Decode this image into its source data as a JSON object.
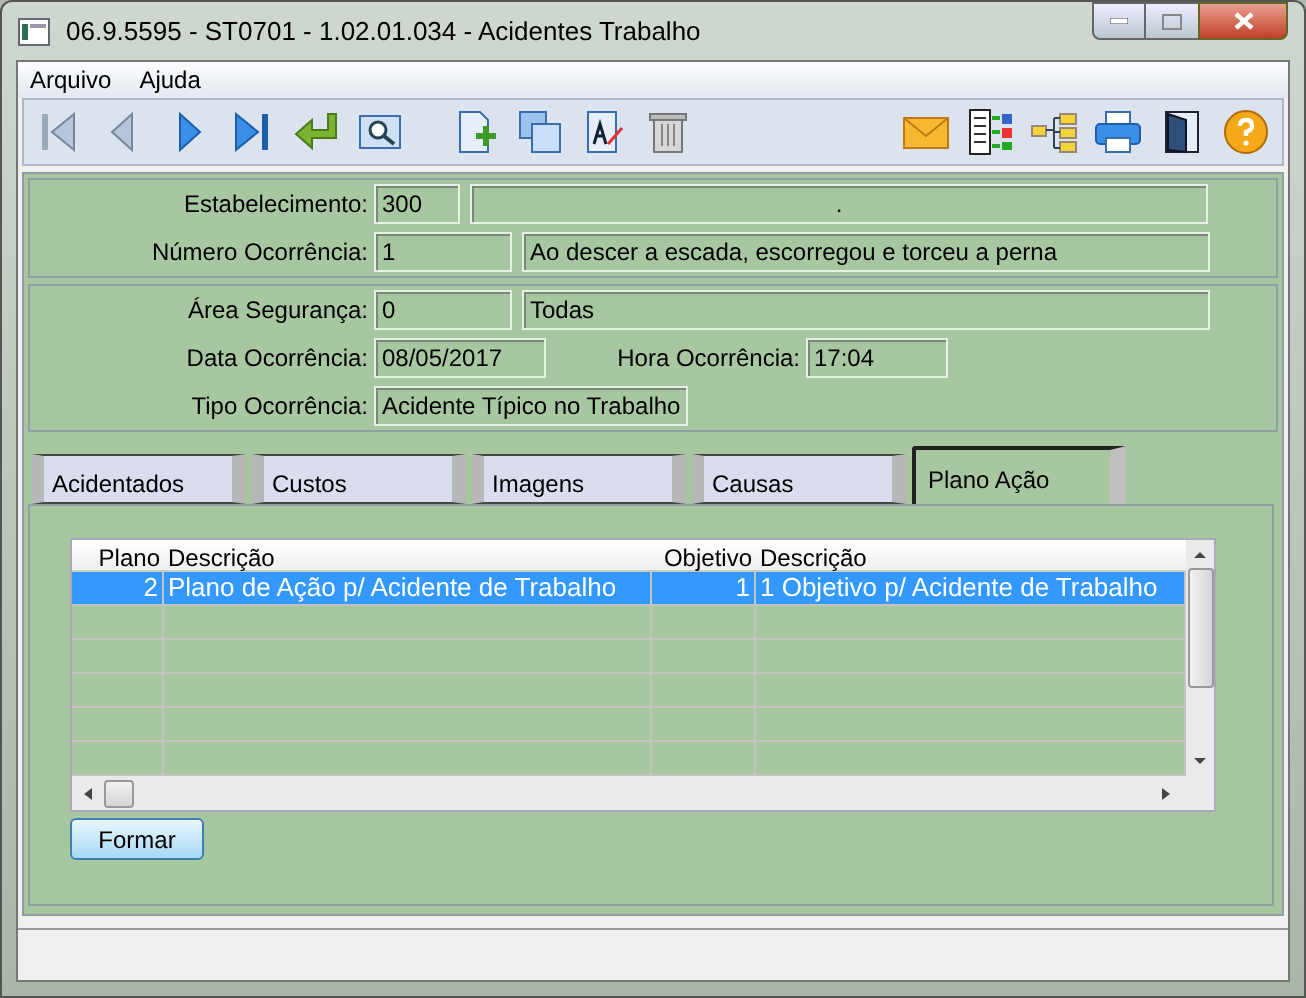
{
  "window": {
    "title": "06.9.5595 - ST0701 - 1.02.01.034 - Acidentes Trabalho"
  },
  "menu": [
    "Arquivo",
    "Ajuda"
  ],
  "sections": [
    {
      "rows": [
        {
          "label": "Estabelecimento:",
          "fields": [
            "300",
            "."
          ]
        },
        {
          "label": "Número Ocorrência:",
          "fields": [
            "1",
            "Ao descer a escada, escorregou e torceu a perna"
          ]
        }
      ]
    },
    {
      "rows": [
        {
          "label": "Área Segurança:",
          "fields": [
            "0",
            "Todas"
          ]
        },
        {
          "label": "Data Ocorrência:",
          "fields": [
            "08/05/2017"
          ],
          "extra": {
            "label": "Hora Ocorrência:",
            "value": "17:04"
          }
        },
        {
          "label": "Tipo Ocorrência:",
          "fields": [
            "Acidente Típico no Trabalho"
          ]
        }
      ]
    }
  ],
  "tabs": [
    {
      "label": "Acidentados",
      "selected": false
    },
    {
      "label": "Custos",
      "selected": false
    },
    {
      "label": "Imagens",
      "selected": false
    },
    {
      "label": "Causas",
      "selected": false
    },
    {
      "label": "Plano Ação",
      "selected": true
    }
  ],
  "table": {
    "columns": [
      "Plano",
      "Descrição",
      "Objetivo",
      "Descrição"
    ],
    "rows": [
      {
        "cells": [
          "2",
          "Plano de Ação p/ Acidente de Trabalho",
          "1",
          "1 Objetivo p/ Acidente de Trabalho"
        ],
        "selected": true
      }
    ]
  },
  "button": {
    "label": "Formar"
  }
}
